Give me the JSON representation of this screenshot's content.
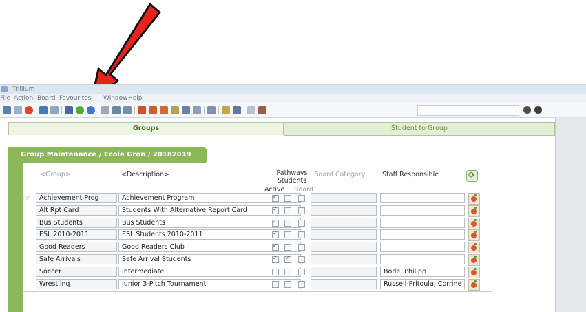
{
  "window": {
    "title": "Trillium"
  },
  "menu": [
    "File",
    "Action",
    "Board",
    "Favourites",
    "Window",
    "Help"
  ],
  "toolbar": {
    "icons": [
      "person-icon",
      "magnify-icon",
      "stop-icon",
      "monitor-icon",
      "printer-icon",
      "save-icon",
      "add-icon",
      "remove-icon",
      "list-icon",
      "users-icon",
      "users-icon",
      "apple-icon",
      "apple-icon",
      "apple-icon",
      "gear-icon",
      "users-icon",
      "report-icon",
      "report-icon",
      "folder-icon",
      "users-icon",
      "calendar-icon",
      "grid-icon"
    ],
    "search_value": ""
  },
  "tabs": [
    {
      "label": "Groups",
      "active": true
    },
    {
      "label": "Student to Group",
      "active": false
    }
  ],
  "panel": {
    "title": "Group Maintenance  / Ecole Gron / 20182019"
  },
  "headers": {
    "group": "<Group>",
    "description": "<Description>",
    "active": "Active",
    "pathways": "Pathways\nStudents",
    "board": "Board",
    "board_category": "Board Category",
    "staff": "Staff Responsible"
  },
  "rows": [
    {
      "group": "Achievement Prog",
      "description": "Achievement Program",
      "active": true,
      "pathways": false,
      "board": false,
      "category": "",
      "staff": ""
    },
    {
      "group": "Alt Rpt Card",
      "description": "Students With Alternative Report Card",
      "active": true,
      "pathways": false,
      "board": false,
      "category": "",
      "staff": ""
    },
    {
      "group": "Bus Students",
      "description": "Bus Students",
      "active": true,
      "pathways": false,
      "board": false,
      "category": "",
      "staff": ""
    },
    {
      "group": "ESL 2010-2011",
      "description": "ESL Students 2010-2011",
      "active": true,
      "pathways": false,
      "board": false,
      "category": "",
      "staff": ""
    },
    {
      "group": "Good Readers",
      "description": "Good Readers Club",
      "active": true,
      "pathways": false,
      "board": false,
      "category": "",
      "staff": ""
    },
    {
      "group": "Safe Arrivals",
      "description": "Safe Arrival Students",
      "active": true,
      "pathways": true,
      "board": false,
      "category": "",
      "staff": ""
    },
    {
      "group": "Soccer",
      "description": "Intermediate",
      "active": false,
      "pathways": false,
      "board": false,
      "category": "",
      "staff": "Bode, Philipp"
    },
    {
      "group": "Wrestling",
      "description": "Junior 3-Pitch Tournament",
      "active": false,
      "pathways": false,
      "board": false,
      "category": "",
      "staff": "Russell-Pritoula, Corrine"
    }
  ],
  "colors": {
    "accent_green": "#8db85a",
    "arrow_red": "#e8231c"
  }
}
